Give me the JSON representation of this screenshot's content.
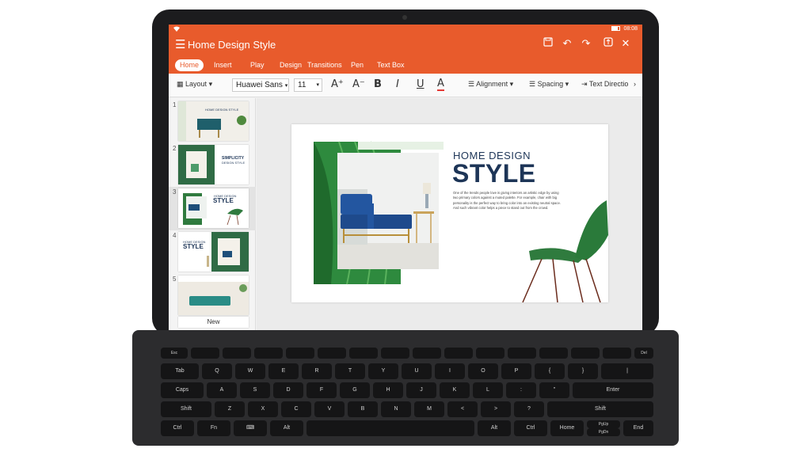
{
  "status_bar": {
    "wifi_icon": "wifi-icon",
    "time": "08:08"
  },
  "app": {
    "title": "Home Design Style",
    "accent": "#e85b2c"
  },
  "tabs": [
    "Home",
    "Insert",
    "Play",
    "Design",
    "Transitions",
    "Pen",
    "Text Box"
  ],
  "toolbar": {
    "layout_label": "Layout",
    "font_name": "Huawei Sans",
    "font_size": "11",
    "grow_glyph": "A⁺",
    "shrink_glyph": "A⁻",
    "bold_glyph": "B",
    "italic_glyph": "I",
    "underline_glyph": "U",
    "color_glyph": "A",
    "alignment_label": "Alignment",
    "spacing_label": "Spacing",
    "text_direction_label": "Text Directio"
  },
  "slides": {
    "numbers": [
      "1",
      "2",
      "3",
      "4",
      "5"
    ],
    "new_label": "New",
    "thumb1_title": "HOME DESIGN STYLE",
    "thumb2_title": "SIMPLICITY",
    "thumb2_sub": "DESIGN STYLE",
    "thumb3_kicker": "HOME DESIGN",
    "thumb3_title": "STYLE",
    "thumb4_kicker": "HOME DESIGN",
    "thumb4_title": "STYLE"
  },
  "slide": {
    "kicker": "HOME DESIGN",
    "title": "STYLE",
    "body": "One of the trends people love is giving interiors an artistic edge by using two primary colors against a muted palette. For example, chair with big personality is the perfect way to bring color into an existing neutral space. And such vibrant color helps a piece to stand out from the crowd."
  },
  "keyboard": {
    "row0": [
      "Esc",
      "",
      "",
      "",
      "",
      "",
      "",
      "",
      "",
      "",
      "",
      "",
      "",
      "",
      "Del"
    ],
    "row1": [
      "Tab",
      "Q",
      "W",
      "E",
      "R",
      "T",
      "Y",
      "U",
      "I",
      "O",
      "P",
      "{",
      "}",
      "|"
    ],
    "row2": [
      "Caps",
      "A",
      "S",
      "D",
      "F",
      "G",
      "H",
      "J",
      "K",
      "L",
      ":",
      "\"",
      "Enter"
    ],
    "row3": [
      "Shift",
      "Z",
      "X",
      "C",
      "V",
      "B",
      "N",
      "M",
      "<",
      ">",
      "?",
      "Shift"
    ],
    "row4": [
      "Ctrl",
      "Fn",
      "⌨",
      "Alt",
      "",
      "Alt",
      "Ctrl",
      "Home",
      "PgUp",
      "PgDn",
      "End"
    ]
  }
}
